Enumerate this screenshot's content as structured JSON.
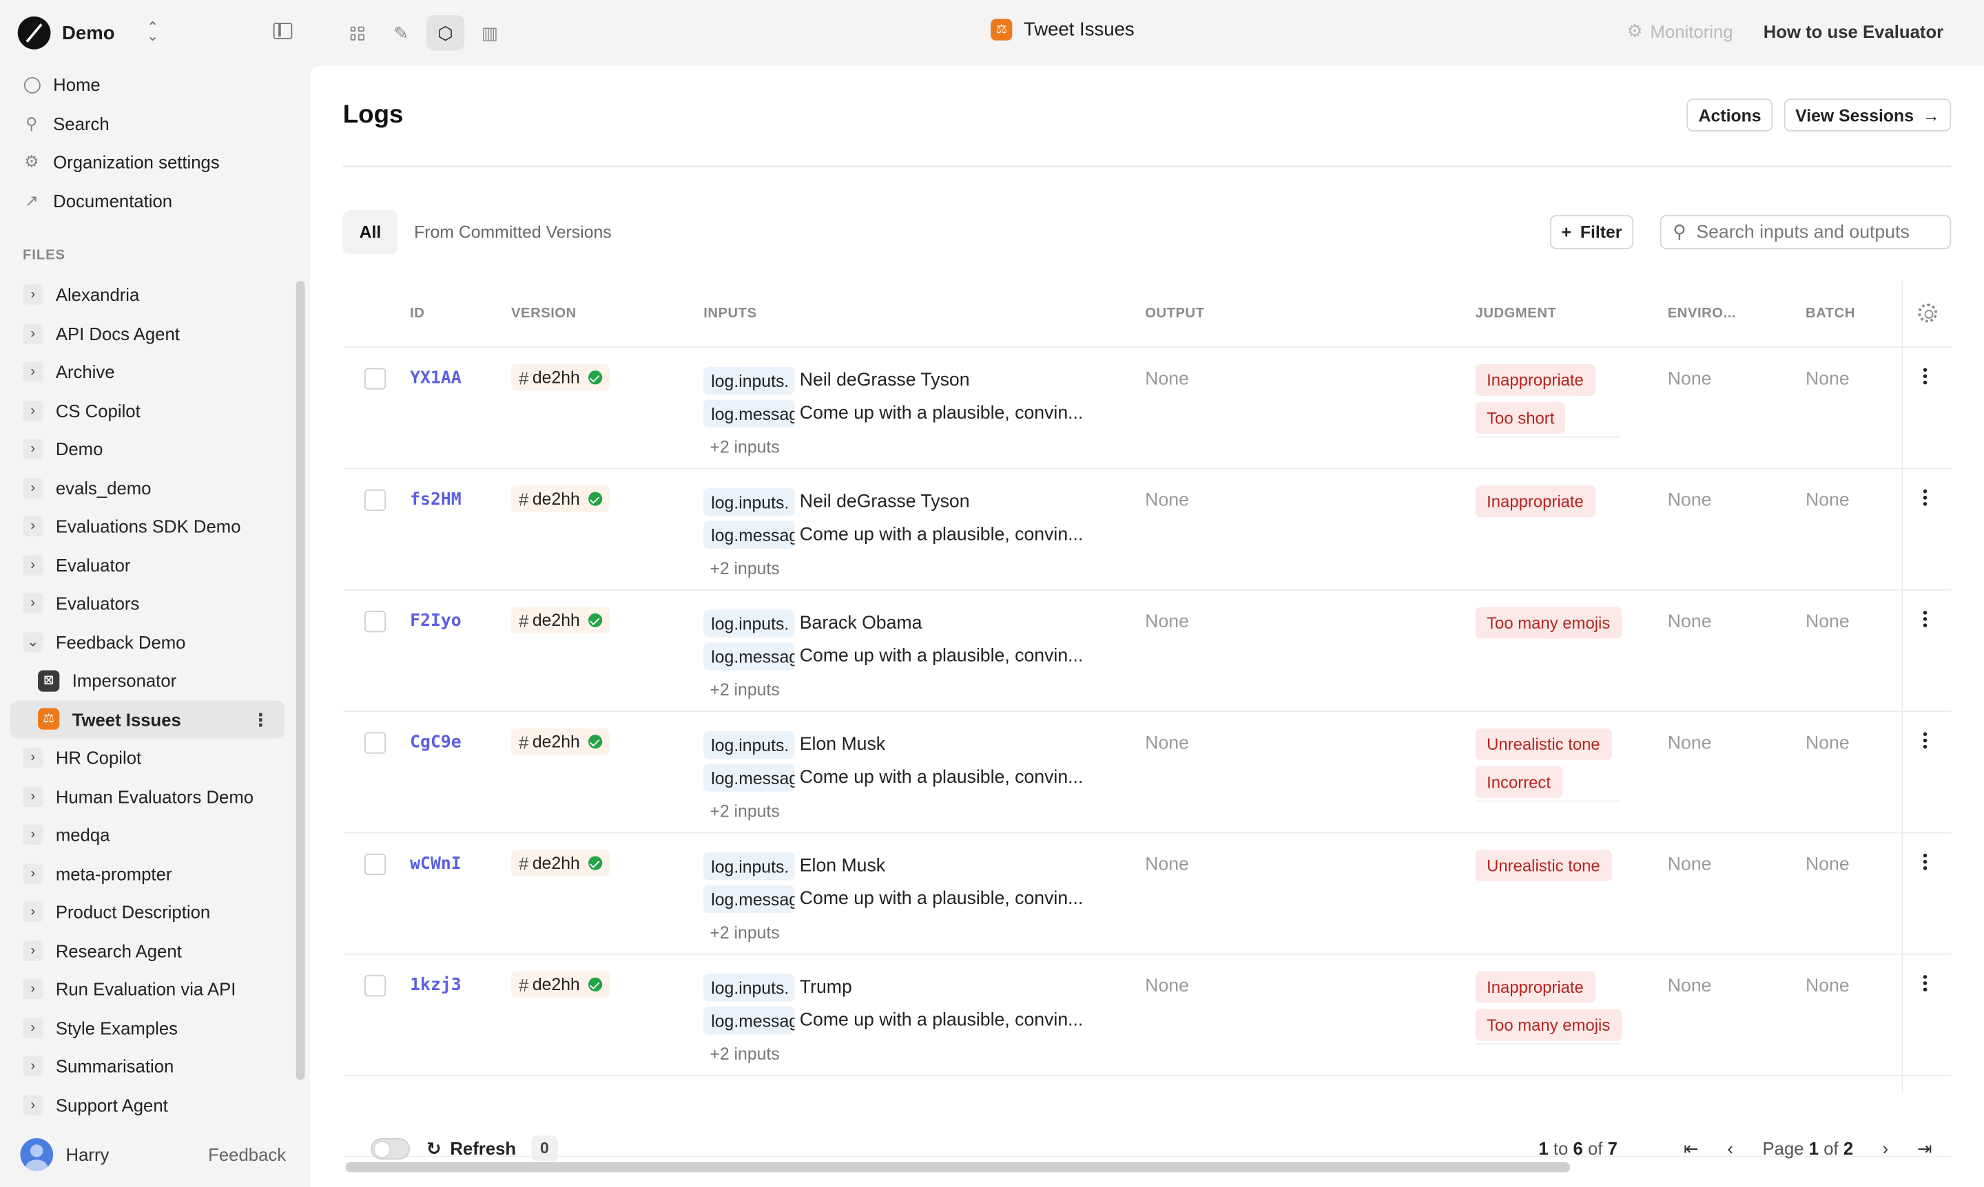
{
  "workspace": {
    "name": "Demo"
  },
  "nav": [
    {
      "label": "Home",
      "icon": "home-icon"
    },
    {
      "label": "Search",
      "icon": "search-icon"
    },
    {
      "label": "Organization settings",
      "icon": "gear-icon"
    },
    {
      "label": "Documentation",
      "icon": "external-link-icon"
    }
  ],
  "files_label": "FILES",
  "tree": [
    {
      "label": "Alexandria",
      "type": "folder"
    },
    {
      "label": "API Docs Agent",
      "type": "folder"
    },
    {
      "label": "Archive",
      "type": "folder"
    },
    {
      "label": "CS Copilot",
      "type": "folder"
    },
    {
      "label": "Demo",
      "type": "folder"
    },
    {
      "label": "evals_demo",
      "type": "folder"
    },
    {
      "label": "Evaluations SDK Demo",
      "type": "folder"
    },
    {
      "label": "Evaluator",
      "type": "folder"
    },
    {
      "label": "Evaluators",
      "type": "folder"
    },
    {
      "label": "Feedback Demo",
      "type": "folder-open"
    },
    {
      "label": "Impersonator",
      "type": "file-prompt"
    },
    {
      "label": "Tweet Issues",
      "type": "file-evaluator",
      "active": true
    },
    {
      "label": "HR Copilot",
      "type": "folder"
    },
    {
      "label": "Human Evaluators Demo",
      "type": "folder"
    },
    {
      "label": "medqa",
      "type": "folder"
    },
    {
      "label": "meta-prompter",
      "type": "folder"
    },
    {
      "label": "Product Description",
      "type": "folder"
    },
    {
      "label": "Research Agent",
      "type": "folder"
    },
    {
      "label": "Run Evaluation via API",
      "type": "folder"
    },
    {
      "label": "Style Examples",
      "type": "folder"
    },
    {
      "label": "Summarisation",
      "type": "folder"
    },
    {
      "label": "Support Agent",
      "type": "folder"
    }
  ],
  "user": {
    "name": "Harry",
    "feedback_label": "Feedback"
  },
  "topbar": {
    "title": "Tweet Issues",
    "monitoring_label": "Monitoring",
    "howto_label": "How to use Evaluator"
  },
  "page": {
    "title": "Logs",
    "actions_label": "Actions",
    "view_sessions_label": "View Sessions",
    "tabs": [
      "All",
      "From Committed Versions"
    ],
    "filter_label": "Filter",
    "search_placeholder": "Search inputs and outputs"
  },
  "table": {
    "columns": [
      "ID",
      "VERSION",
      "INPUTS",
      "OUTPUT",
      "JUDGMENT",
      "ENVIRO...",
      "BATCH"
    ],
    "rows": [
      {
        "id": "YX1AA",
        "version": "de2hh",
        "input1_key": "log.inputs.",
        "input1_val": "Neil deGrasse Tyson",
        "input2_key": "log.messages",
        "input2_val": "Come up with a plausible, convin...",
        "more": "+2 inputs",
        "output": "None",
        "judgments": [
          "Inappropriate",
          "Too short"
        ],
        "environment": "None",
        "batch": "None"
      },
      {
        "id": "fs2HM",
        "version": "de2hh",
        "input1_key": "log.inputs.",
        "input1_val": "Neil deGrasse Tyson",
        "input2_key": "log.messages",
        "input2_val": "Come up with a plausible, convin...",
        "more": "+2 inputs",
        "output": "None",
        "judgments": [
          "Inappropriate"
        ],
        "environment": "None",
        "batch": "None"
      },
      {
        "id": "F2Iyo",
        "version": "de2hh",
        "input1_key": "log.inputs.",
        "input1_val": "Barack Obama",
        "input2_key": "log.messages",
        "input2_val": "Come up with a plausible, convin...",
        "more": "+2 inputs",
        "output": "None",
        "judgments": [
          "Too many emojis"
        ],
        "environment": "None",
        "batch": "None"
      },
      {
        "id": "CgC9e",
        "version": "de2hh",
        "input1_key": "log.inputs.",
        "input1_val": "Elon Musk",
        "input2_key": "log.messages",
        "input2_val": "Come up with a plausible, convin...",
        "more": "+2 inputs",
        "output": "None",
        "judgments": [
          "Unrealistic tone",
          "Incorrect"
        ],
        "environment": "None",
        "batch": "None"
      },
      {
        "id": "wCWnI",
        "version": "de2hh",
        "input1_key": "log.inputs.",
        "input1_val": "Elon Musk",
        "input2_key": "log.messages",
        "input2_val": "Come up with a plausible, convin...",
        "more": "+2 inputs",
        "output": "None",
        "judgments": [
          "Unrealistic tone"
        ],
        "environment": "None",
        "batch": "None"
      },
      {
        "id": "1kzj3",
        "version": "de2hh",
        "input1_key": "log.inputs.",
        "input1_val": "Trump",
        "input2_key": "log.messages",
        "input2_val": "Come up with a plausible, convin...",
        "more": "+2 inputs",
        "output": "None",
        "judgments": [
          "Inappropriate",
          "Too many emojis"
        ],
        "environment": "None",
        "batch": "None"
      }
    ]
  },
  "footer": {
    "refresh_label": "Refresh",
    "refresh_count": "0",
    "range_from": "1",
    "range_to": "6",
    "range_total": "7",
    "page_label": "Page",
    "page_current": "1",
    "page_total": "2",
    "to_word": "to",
    "of_word": "of"
  },
  "colors": {
    "accent_id": "#5b5fe0",
    "judgment_bg": "#fde8e8",
    "judgment_text": "#b3261e",
    "evaluator_icon": "#ec7a1c"
  }
}
